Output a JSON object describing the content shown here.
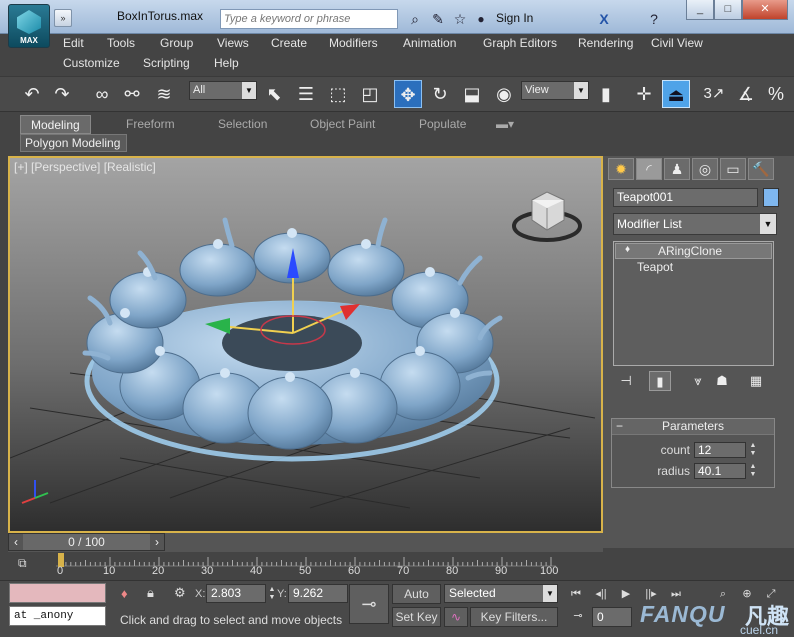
{
  "window": {
    "app_label": "MAX",
    "title": "BoxInTorus.max",
    "search_placeholder": "Type a keyword or phrase",
    "signin": "Sign In"
  },
  "menu": [
    "Edit",
    "Tools",
    "Group",
    "Views",
    "Create",
    "Modifiers",
    "Animation",
    "Graph Editors",
    "Rendering",
    "Civil View",
    "Customize",
    "Scripting",
    "Help"
  ],
  "toolbar": {
    "selection_filter": "All",
    "reference_coord": "View",
    "snap_label": "3"
  },
  "ribbon": {
    "tabs": [
      "Modeling",
      "Freeform",
      "Selection",
      "Object Paint",
      "Populate"
    ],
    "active_tab": "Modeling",
    "panel": "Polygon Modeling"
  },
  "viewport": {
    "label": "[+] [Perspective] [Realistic]"
  },
  "command_panel": {
    "object_name": "Teapot001",
    "object_color": "#7fb7ef",
    "modifier_list": "Modifier List",
    "stack": [
      "ARingClone",
      "Teapot"
    ],
    "rollout_title": "Parameters",
    "params": [
      {
        "label": "count",
        "value": "12"
      },
      {
        "label": "radius",
        "value": "40.1"
      }
    ]
  },
  "timeline": {
    "frame_display": "0 / 100",
    "ticks": [
      "0",
      "10",
      "20",
      "30",
      "40",
      "50",
      "60",
      "70",
      "80",
      "90",
      "100"
    ]
  },
  "status": {
    "listener_text": "at _anony",
    "x_label": "X:",
    "x_value": "2.803",
    "y_label": "Y:",
    "y_value": "9.262",
    "prompt": "Click and drag to select and move objects",
    "autokey": "Auto Key",
    "setkey": "Set Key",
    "key_mode": "Selected",
    "key_filters": "Key Filters...",
    "current_frame": "0"
  },
  "watermark": {
    "brand": "FANQU",
    "cn": "凡趣",
    "sub": "cuel.cn"
  }
}
